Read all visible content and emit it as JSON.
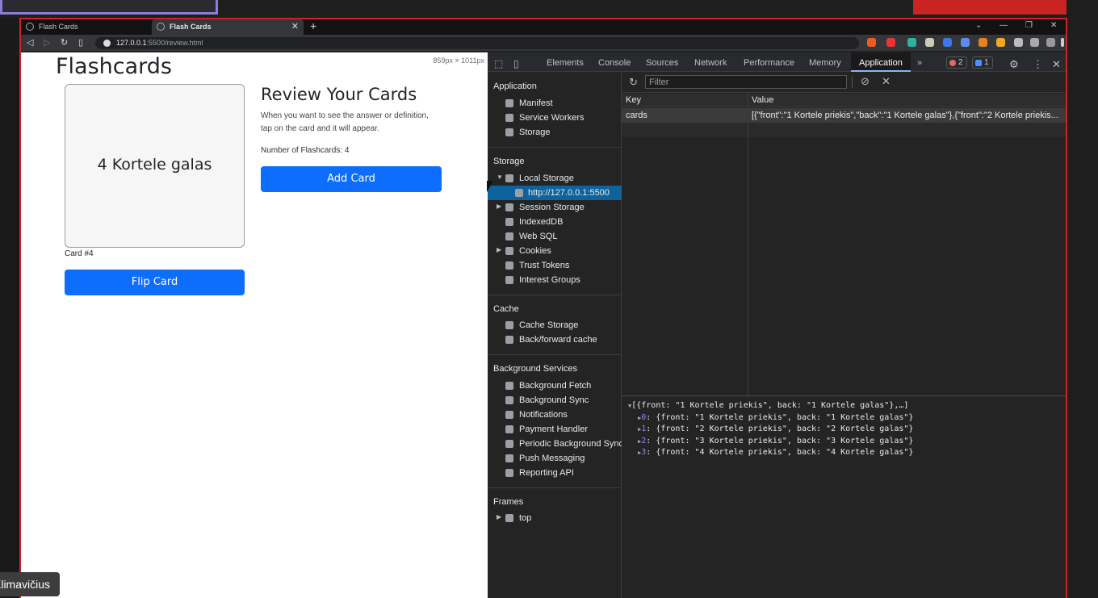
{
  "browser": {
    "tabs": [
      {
        "title": "Flash Cards"
      },
      {
        "title": "Flash Cards"
      }
    ],
    "new_tab": "+",
    "url_host": "127.0.0.1",
    "url_path": ":5500/review.html",
    "win_min": "—",
    "win_restore": "❐",
    "win_close": "✕",
    "win_chevron": "⌄"
  },
  "page": {
    "title": "Flashcards",
    "dimensions": "859px × 1011px",
    "card_text": "4 Kortele galas",
    "card_number": "Card #4",
    "flip_button": "Flip Card",
    "review_title": "Review Your Cards",
    "review_desc": "When you want to see the answer or definition, tap on the card and it will appear.",
    "card_count": "Number of Flashcards: 4",
    "add_button": "Add Card"
  },
  "devtools": {
    "tabs": [
      "Elements",
      "Console",
      "Sources",
      "Network",
      "Performance",
      "Memory",
      "Application"
    ],
    "active_tab": "Application",
    "more": "»",
    "error_count": "2",
    "message_count": "1",
    "sidebar": {
      "application_header": "Application",
      "application_items": [
        "Manifest",
        "Service Workers",
        "Storage"
      ],
      "storage_header": "Storage",
      "storage_items": [
        "Local Storage",
        "http://127.0.0.1:5500",
        "Session Storage",
        "IndexedDB",
        "Web SQL",
        "Cookies",
        "Trust Tokens",
        "Interest Groups"
      ],
      "cache_header": "Cache",
      "cache_items": [
        "Cache Storage",
        "Back/forward cache"
      ],
      "bg_header": "Background Services",
      "bg_items": [
        "Background Fetch",
        "Background Sync",
        "Notifications",
        "Payment Handler",
        "Periodic Background Sync",
        "Push Messaging",
        "Reporting API"
      ],
      "frames_header": "Frames",
      "frames_items": [
        "top"
      ]
    },
    "filter_placeholder": "Filter",
    "grid": {
      "key_header": "Key",
      "value_header": "Value",
      "row_key": "cards",
      "row_value": "[{\"front\":\"1 Kortele priekis\",\"back\":\"1 Kortele galas\"},{\"front\":\"2 Kortele priekis..."
    },
    "preview": {
      "summary": "[{front: \"1 Kortele priekis\", back: \"1 Kortele galas\"},…]",
      "items": [
        {
          "idx": "0",
          "text": "{front: \"1 Kortele priekis\", back: \"1 Kortele galas\"}"
        },
        {
          "idx": "1",
          "text": "{front: \"2 Kortele priekis\", back: \"2 Kortele galas\"}"
        },
        {
          "idx": "2",
          "text": "{front: \"3 Kortele priekis\", back: \"3 Kortele galas\"}"
        },
        {
          "idx": "3",
          "text": "{front: \"4 Kortele priekis\", back: \"4 Kortele galas\"}"
        }
      ]
    }
  },
  "overlay": {
    "name": "Klimavičius"
  },
  "colors": {
    "accent": "#0d6efd",
    "frame": "#d0202a",
    "selection": "#0e639c"
  }
}
